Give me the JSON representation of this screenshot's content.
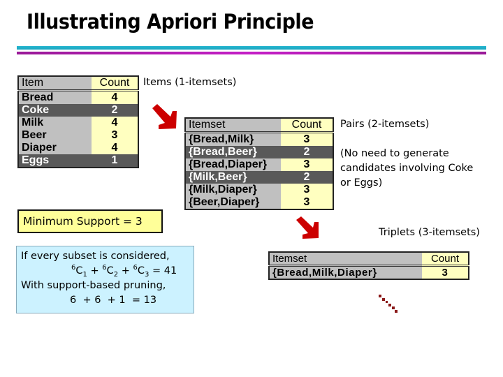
{
  "title": "Illustrating Apriori Principle",
  "colors": {
    "rule_top": "#1aa6c0",
    "rule_bottom": "#b01cb0",
    "arrow": "#cc0000",
    "dotted_arrow": "#8b1a1a",
    "item_col": "#c0c0c0",
    "count_col": "#ffffc0",
    "pruned_row": "#595959",
    "min_support_box": "#ffff99",
    "calc_box": "#ccf2ff"
  },
  "table1": {
    "label": "Items (1-itemsets)",
    "headers": [
      "Item",
      "Count"
    ],
    "rows": [
      {
        "item": "Bread",
        "count": "4",
        "pruned": false
      },
      {
        "item": "Coke",
        "count": "2",
        "pruned": true
      },
      {
        "item": "Milk",
        "count": "4",
        "pruned": false
      },
      {
        "item": "Beer",
        "count": "3",
        "pruned": false
      },
      {
        "item": "Diaper",
        "count": "4",
        "pruned": false
      },
      {
        "item": "Eggs",
        "count": "1",
        "pruned": true
      }
    ]
  },
  "table2": {
    "label": "Pairs (2-itemsets)",
    "note": [
      "(No need to generate",
      "candidates involving Coke",
      "or Eggs)"
    ],
    "headers": [
      "Itemset",
      "Count"
    ],
    "rows": [
      {
        "item": "{Bread,Milk}",
        "count": "3",
        "pruned": false
      },
      {
        "item": "{Bread,Beer}",
        "count": "2",
        "pruned": true
      },
      {
        "item": "{Bread,Diaper}",
        "count": "3",
        "pruned": false
      },
      {
        "item": "{Milk,Beer}",
        "count": "2",
        "pruned": true
      },
      {
        "item": "{Milk,Diaper}",
        "count": "3",
        "pruned": false
      },
      {
        "item": "{Beer,Diaper}",
        "count": "3",
        "pruned": false
      }
    ]
  },
  "table3": {
    "label": "Triplets (3-itemsets)",
    "headers": [
      "Itemset",
      "Count"
    ],
    "rows": [
      {
        "item": "{Bread,Milk,Diaper}",
        "count": "3",
        "pruned": false
      }
    ]
  },
  "min_support": "Minimum Support = 3",
  "calc": {
    "line1": "If every subset is considered,",
    "line2": {
      "n": "6",
      "k1": "1",
      "k2": "2",
      "k3": "3",
      "plus": "+",
      "eq": "= 41"
    },
    "line3": "With support-based pruning,",
    "line4": "6  + 6  + 1  = 13"
  },
  "icons": {
    "arrow1": "red-down-right-arrow",
    "arrow2": "red-down-right-arrow",
    "arrow3": "dotted-down-right-arrow"
  }
}
